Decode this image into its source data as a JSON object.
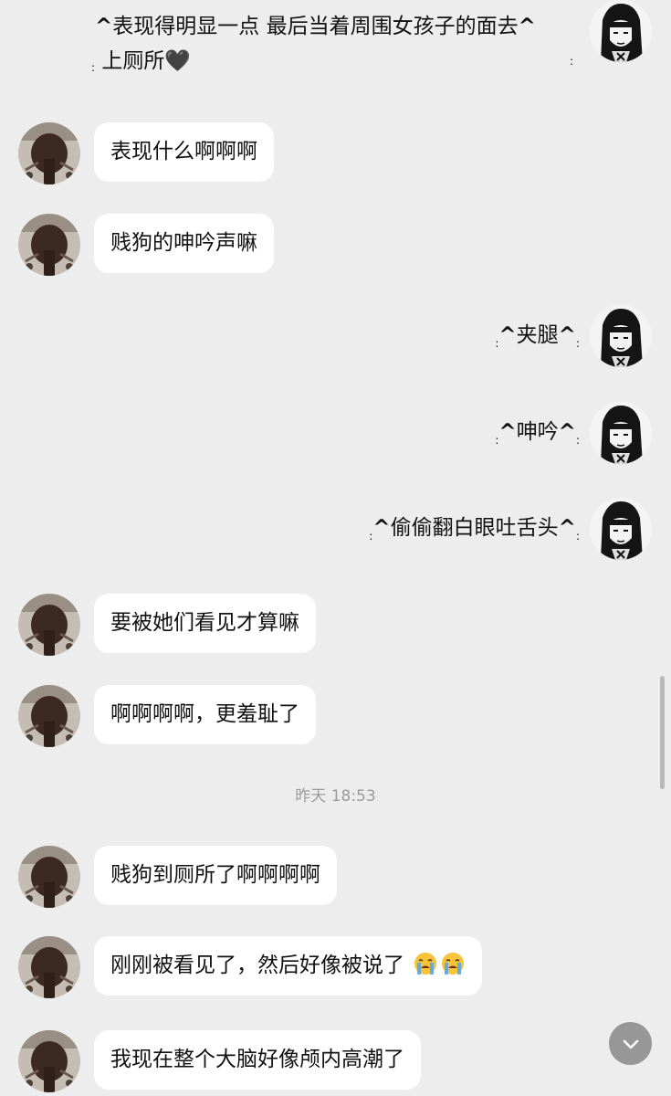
{
  "messages": [
    {
      "side": "right",
      "line1": "表现得明显一点 最后当着周围女孩子的面去",
      "line2": "上厕所🖤"
    },
    {
      "side": "left",
      "text": "表现什么啊啊啊"
    },
    {
      "side": "left",
      "text": "贱狗的呻吟声嘛"
    },
    {
      "side": "right",
      "text": "夹腿"
    },
    {
      "side": "right",
      "text": "呻吟"
    },
    {
      "side": "right",
      "text": "偷偷翻白眼吐舌头"
    },
    {
      "side": "left",
      "text": "要被她们看见才算嘛"
    },
    {
      "side": "left",
      "text": "啊啊啊啊，更羞耻了"
    },
    {
      "side": "left",
      "text": "贱狗到厕所了啊啊啊啊"
    },
    {
      "side": "left",
      "text": "刚刚被看见了，然后好像被说了"
    },
    {
      "side": "left",
      "text": "我现在整个大脑好像颅内高潮了"
    }
  ],
  "timestamp": "昨天 18:53",
  "icons": {
    "scroll_down": "chevron-down-icon",
    "crying": "loudly-crying-face-emoji"
  }
}
